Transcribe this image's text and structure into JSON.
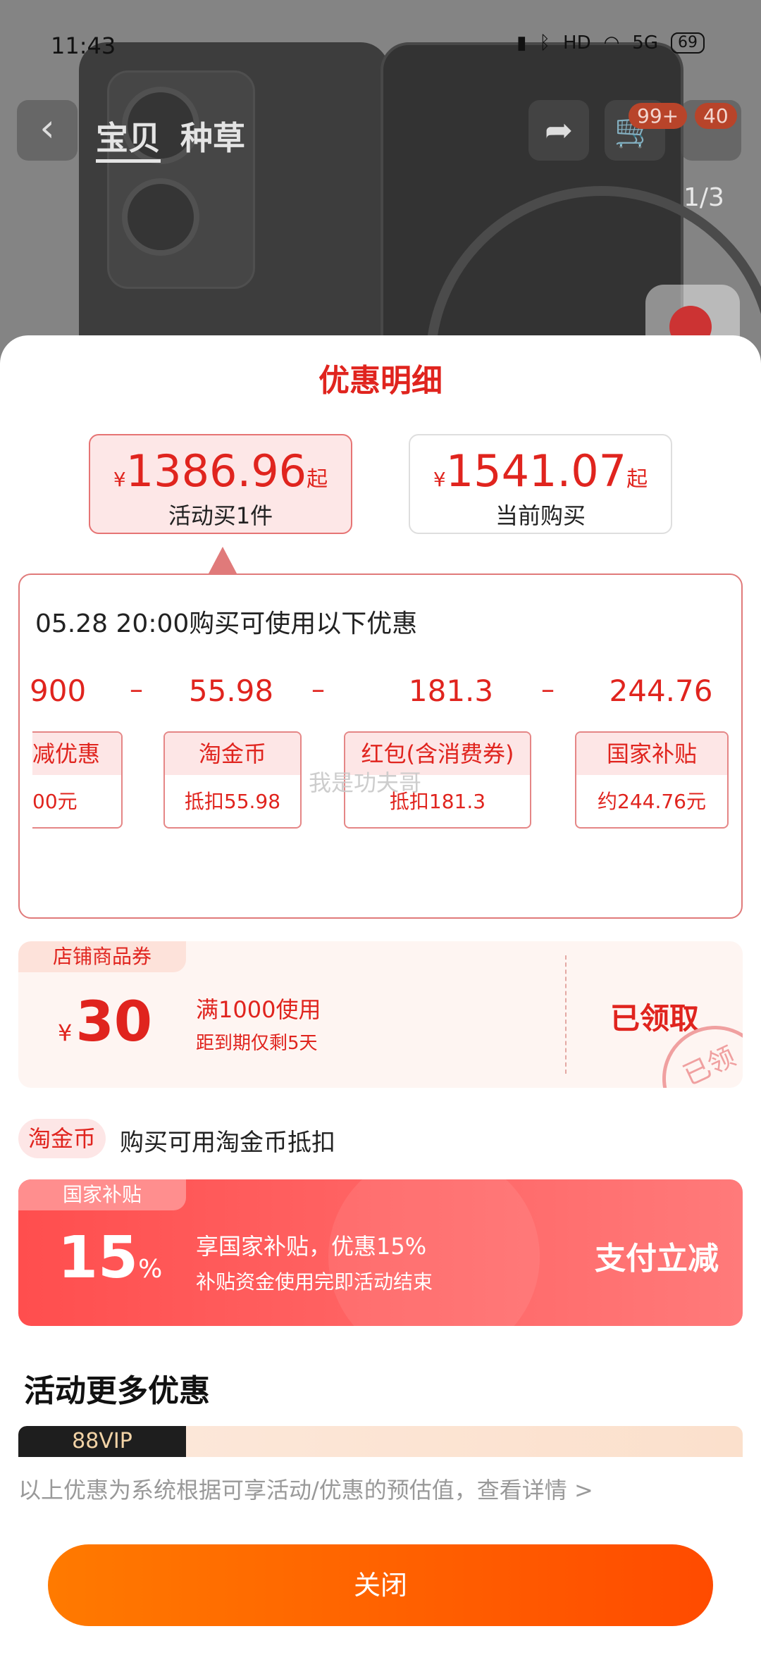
{
  "status_bar": {
    "time": "11:43",
    "network": "5G",
    "hd": "HD",
    "battery": "69"
  },
  "nav": {
    "back_icon": "chevron-left-icon",
    "tabs": [
      "宝贝",
      "种草"
    ],
    "cart_badge": "99+",
    "message_badge": "40",
    "page_indicator": "1/3"
  },
  "sheet": {
    "title": "优惠明细",
    "price_options": [
      {
        "currency": "¥",
        "price": "1386.96",
        "suffix": "起",
        "label": "活动买1件"
      },
      {
        "currency": "¥",
        "price": "1541.07",
        "suffix": "起",
        "label": "当前购买"
      }
    ],
    "detail": {
      "heading": "05.28 20:00购买可使用以下优惠",
      "amounts": [
        "900",
        "55.98",
        "181.3",
        "244.76"
      ],
      "minus": "–",
      "items": [
        {
          "title": "减优惠",
          "desc": "00元"
        },
        {
          "title": "淘金币",
          "desc": "抵扣55.98"
        },
        {
          "title": "红包(含消费券)",
          "desc": "抵扣181.3"
        },
        {
          "title": "国家补贴",
          "desc": "约244.76元"
        }
      ],
      "watermark": "我是功夫哥"
    },
    "store_coupon": {
      "tag": "店铺商品券",
      "currency": "¥",
      "amount": "30",
      "condition": "满1000使用",
      "expiry": "距到期仅剩5天",
      "status": "已领取",
      "stamp": "已领"
    },
    "coin": {
      "tag": "淘金币",
      "text": "购买可用淘金币抵扣"
    },
    "subsidy": {
      "tag": "国家补贴",
      "percent": "15",
      "unit": "%",
      "main": "享国家补贴，优惠15%",
      "sub": "补贴资金使用完即活动结束",
      "action": "支付立减"
    },
    "more_title": "活动更多优惠",
    "vip_tag": "88VIP",
    "disclaimer": "以上优惠为系统根据可享活动/优惠的预估值，查看详情 >",
    "close_label": "关闭"
  },
  "colors": {
    "accent": "#e0241e",
    "button_start": "#ff7a00",
    "button_end": "#ff4b00",
    "subsidy": "#ff5a5a"
  }
}
